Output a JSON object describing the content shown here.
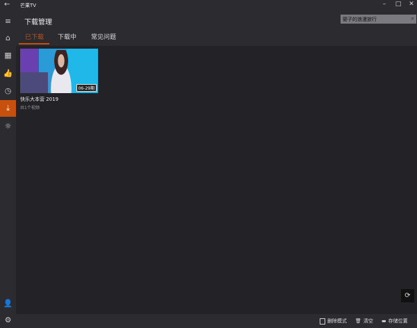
{
  "window": {
    "title": "芒果TV",
    "minimize": "–",
    "maximize": "□",
    "close": "✕"
  },
  "sidebar": {
    "items": [
      {
        "name": "menu",
        "icon": "≡"
      },
      {
        "name": "home",
        "icon": "⌂"
      },
      {
        "name": "categories",
        "icon": "▦"
      },
      {
        "name": "likes",
        "icon": "👍"
      },
      {
        "name": "history",
        "icon": "◷"
      },
      {
        "name": "downloads",
        "icon": "⤓"
      },
      {
        "name": "theme",
        "icon": "☼"
      },
      {
        "name": "user",
        "icon": "👤"
      },
      {
        "name": "settings",
        "icon": "⚙"
      }
    ]
  },
  "header": {
    "title": "下载管理",
    "search_value": "婴子的浪漫旅行",
    "search_icon": "⌕"
  },
  "tabs": [
    {
      "label": "已下载"
    },
    {
      "label": "下载中"
    },
    {
      "label": "常见问题"
    }
  ],
  "downloads": [
    {
      "title": "快乐大本营 2019",
      "subtitle": "共1个视频",
      "badge": "06-29期"
    }
  ],
  "bottom": {
    "delete_mode": "删除模式",
    "clear": "清空",
    "storage": "存储位置",
    "refresh_icon": "⟳"
  },
  "colors": {
    "accent": "#c8500f"
  }
}
